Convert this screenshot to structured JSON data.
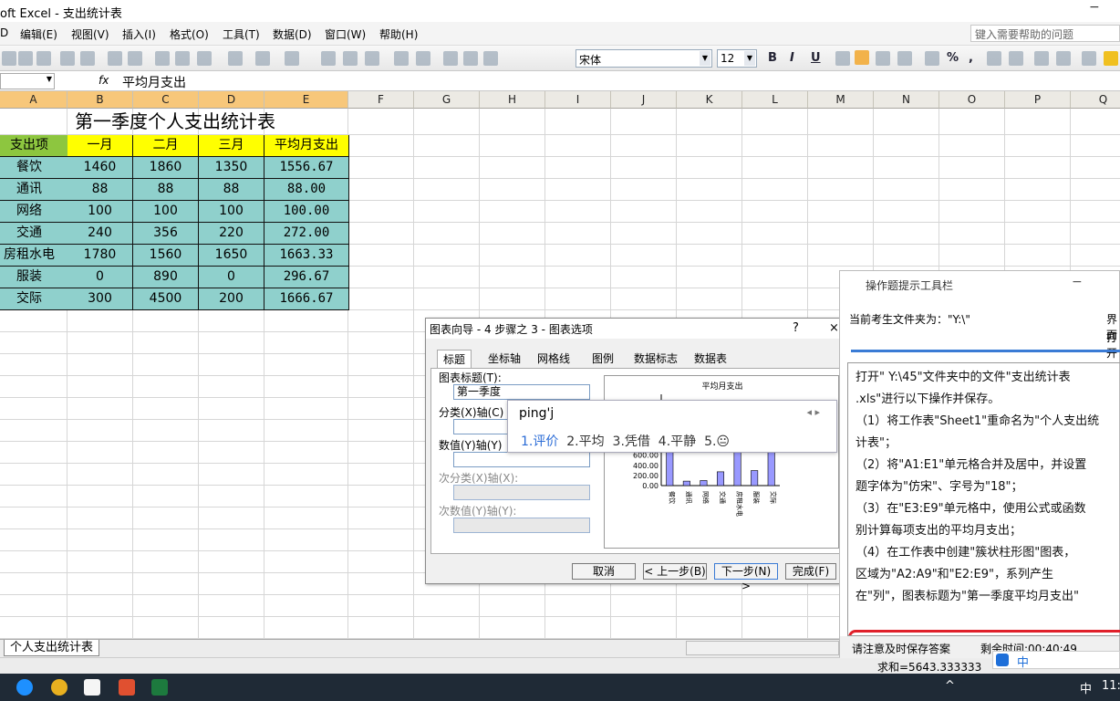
{
  "window": {
    "title": "oft Excel - 支出统计表",
    "controls": {
      "minimize": "−",
      "close": "Ⅹ"
    }
  },
  "menu": {
    "items": [
      "D",
      "编辑(E)",
      "视图(V)",
      "插入(I)",
      "格式(O)",
      "工具(T)",
      "数据(D)",
      "窗口(W)",
      "帮助(H)"
    ],
    "help_placeholder": "键入需要帮助的问题"
  },
  "toolbar": {
    "font": "宋体",
    "size": "12",
    "format_icons": [
      "B",
      "I",
      "U",
      "%",
      ","
    ]
  },
  "formula_bar": {
    "name_box": "",
    "fx": "fx",
    "content": "平均月支出"
  },
  "columns": [
    "A",
    "B",
    "C",
    "D",
    "E",
    "F",
    "G",
    "H",
    "I",
    "J",
    "K",
    "L",
    "M",
    "N",
    "O",
    "P",
    "Q"
  ],
  "sheet": {
    "title": "第一季度个人支出统计表",
    "headers": [
      "支出项",
      "一月",
      "二月",
      "三月",
      "平均月支出"
    ],
    "rows": [
      {
        "item": "餐饮",
        "jan": "1460",
        "feb": "1860",
        "mar": "1350",
        "avg": "1556.67"
      },
      {
        "item": "通讯",
        "jan": "88",
        "feb": "88",
        "mar": "88",
        "avg": "88.00"
      },
      {
        "item": "网络",
        "jan": "100",
        "feb": "100",
        "mar": "100",
        "avg": "100.00"
      },
      {
        "item": "交通",
        "jan": "240",
        "feb": "356",
        "mar": "220",
        "avg": "272.00"
      },
      {
        "item": "房租水电",
        "jan": "1780",
        "feb": "1560",
        "mar": "1650",
        "avg": "1663.33"
      },
      {
        "item": "服装",
        "jan": "0",
        "feb": "890",
        "mar": "0",
        "avg": "296.67"
      },
      {
        "item": "交际",
        "jan": "300",
        "feb": "4500",
        "mar": "200",
        "avg": "1666.67"
      }
    ],
    "tab_name": "个人支出统计表"
  },
  "status_bar": {
    "sum": "求和=5643.333333"
  },
  "dialog": {
    "title": "图表向导 - 4 步骤之 3 - 图表选项",
    "help": "?",
    "close": "×",
    "tabs": [
      "标题",
      "坐标轴",
      "网格线",
      "图例",
      "数据标志",
      "数据表"
    ],
    "fields": {
      "chart_title_label": "图表标题(T):",
      "chart_title_value": "第一季度",
      "x_axis_label": "分类(X)轴(C)",
      "y_axis_label": "数值(Y)轴(Y)",
      "x2_axis_label": "次分类(X)轴(X):",
      "y2_axis_label": "次数值(Y)轴(Y):"
    },
    "preview_title": "平均月支出",
    "buttons": {
      "cancel": "取消",
      "back": "< 上一步(B)",
      "next": "下一步(N) >",
      "finish": "完成(F)"
    }
  },
  "chart_data": {
    "type": "bar",
    "title": "平均月支出",
    "categories": [
      "餐饮",
      "通讯",
      "网络",
      "交通",
      "房租水电",
      "服装",
      "交际"
    ],
    "values": [
      1556.67,
      88.0,
      100.0,
      272.0,
      1663.33,
      296.67,
      1666.67
    ],
    "ytick_labels": [
      "600.00",
      "400.00",
      "200.00",
      "0.00"
    ],
    "bar_color": "#9999ff"
  },
  "ime": {
    "input": "ping'j",
    "arrows": "◂ ▸",
    "candidates": [
      "1.评价",
      "2.平均",
      "3.凭借",
      "4.平静",
      "5.😐"
    ]
  },
  "panel": {
    "title": "操作题提示工具栏",
    "folder": "当前考生文件夹为：\"Y:\\\"",
    "right_top_1": "界面",
    "right_top_2": "打开",
    "instructions": [
      "打开\" Y:\\45\"文件夹中的文件\"支出统计表",
      ".xls\"进行以下操作并保存。",
      "（1）将工作表\"Sheet1\"重命名为\"个人支出统",
      "计表\"；",
      "（2）将\"A1:E1\"单元格合并及居中，并设置",
      "题字体为\"仿宋\"、字号为\"18\"；",
      "（3）在\"E3:E9\"单元格中，使用公式或函数",
      "别计算每项支出的平均月支出；",
      "（4）在工作表中创建\"簇状柱形图\"图表，",
      "区域为\"A2:A9\"和\"E2:E9\"，系列产生",
      "在\"列\"，图表标题为\"第一季度平均月支出\""
    ],
    "save_hint": "请注意及时保存答案",
    "timer": "剩余时间:00:40:49"
  },
  "taskbar": {
    "lang": "中",
    "time": "11:4"
  },
  "colors": {
    "header_yellow": "#ffff00",
    "header_green": "#8dc63f",
    "data_teal": "#8fd0cc",
    "highlight_red": "#e0202a"
  }
}
